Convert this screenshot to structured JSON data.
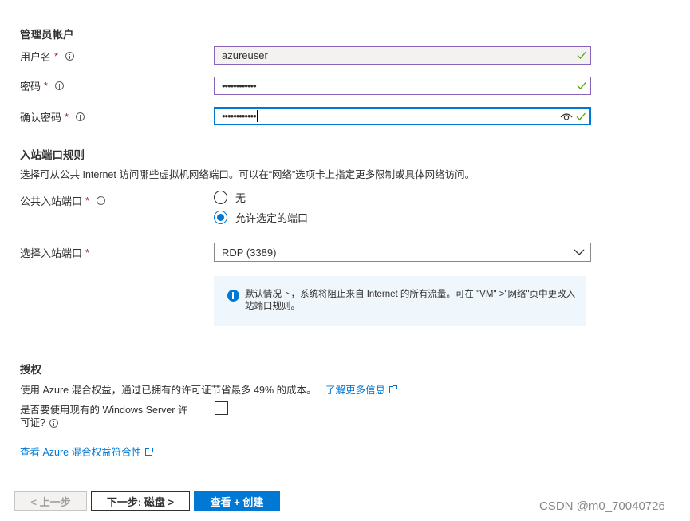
{
  "admin": {
    "title": "管理员帐户",
    "username_label": "用户名",
    "username_value": "azureuser",
    "password_label": "密码",
    "password_value": "••••••••••••",
    "confirm_label": "确认密码",
    "confirm_value": "••••••••••••",
    "required_mark": "*"
  },
  "inbound": {
    "title": "入站端口规则",
    "description": "选择可从公共 Internet 访问哪些虚拟机网络端口。可以在“网络”选项卡上指定更多限制或具体网络访问。",
    "public_label": "公共入站端口",
    "option_none": "无",
    "option_allow": "允许选定的端口",
    "select_label": "选择入站端口",
    "select_value": "RDP (3389)",
    "info_text": "默认情况下，系统将阻止来自 Internet 的所有流量。可在 \"VM\" >\"网络\"页中更改入站端口规则。"
  },
  "license": {
    "title": "授权",
    "description": "使用 Azure 混合权益，通过已拥有的许可证节省最多 49% 的成本。",
    "learn_more": "了解更多信息",
    "question_line1": "是否要使用现有的 Windows Server 许",
    "question_line2": "可证?",
    "compliance_link": "查看 Azure 混合权益符合性"
  },
  "footer": {
    "prev": "< 上一步",
    "next": "下一步: 磁盘 >",
    "review": "查看 + 创建"
  },
  "watermark": "CSDN @m0_70040726",
  "colors": {
    "accent": "#0078d4",
    "valid_border": "#8764b8",
    "check_green": "#57a300",
    "required": "#a4262c"
  }
}
